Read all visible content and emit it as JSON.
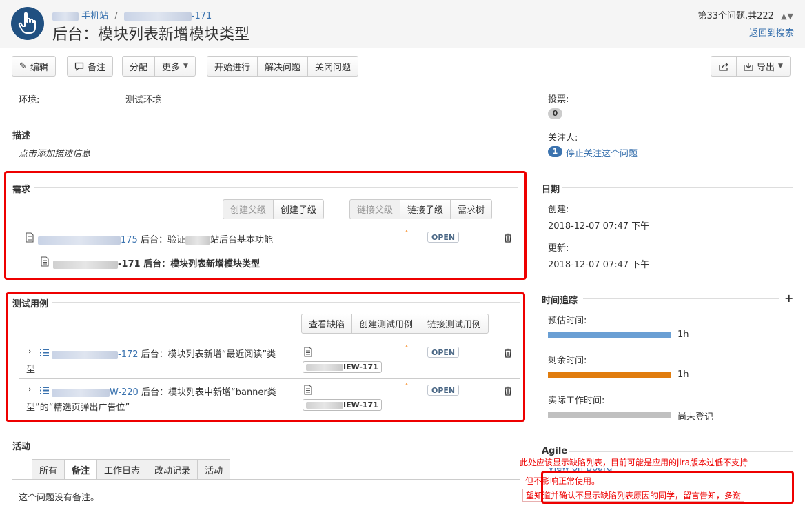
{
  "breadcrumb": {
    "project": "手机站",
    "sep": "/",
    "issue_key_suffix": "-171"
  },
  "title": "后台：模块列表新增模块类型",
  "pager": {
    "position": "第33个问题,共222",
    "arrows": "▲▼",
    "return": "返回到搜索"
  },
  "toolbar": {
    "edit": "编辑",
    "comment": "备注",
    "assign": "分配",
    "more": "更多",
    "start": "开始进行",
    "resolve": "解决问题",
    "close": "关闭问题",
    "export": "导出"
  },
  "details": {
    "env_label": "环境:",
    "env_value": "测试环境"
  },
  "description": {
    "heading": "描述",
    "placeholder": "点击添加描述信息"
  },
  "requirements": {
    "heading": "需求",
    "buttons": [
      "创建父级",
      "创建子级",
      "链接父级",
      "链接子级",
      "需求树"
    ],
    "rows": [
      {
        "key_suffix": "175",
        "summary": "后台：验证",
        "summary_tail": "站后台基本功能",
        "status": "OPEN"
      },
      {
        "key_suffix": "-171",
        "summary": "后台：模块列表新增模块类型"
      }
    ]
  },
  "testcases": {
    "heading": "测试用例",
    "buttons": [
      "查看缺陷",
      "创建测试用例",
      "链接测试用例"
    ],
    "rows": [
      {
        "key_suffix": "-172",
        "summary_1": "后台：模块列表新增“最近阅读”类",
        "summary_2": "型",
        "tag_suffix": "IEW-171",
        "status": "OPEN"
      },
      {
        "key_suffix": "W-220",
        "summary_1": "后台：模块列表中新增“banner类",
        "summary_2": "型”的“精选页弹出广告位”",
        "tag_suffix": "IEW-171",
        "status": "OPEN"
      }
    ]
  },
  "activity": {
    "heading": "活动",
    "tabs": [
      "所有",
      "备注",
      "工作日志",
      "改动记录",
      "活动"
    ],
    "empty": "这个问题没有备注。"
  },
  "people": {
    "votes_label": "投票:",
    "votes": "0",
    "watchers_label": "关注人:",
    "watchers": "1",
    "unwatch": "停止关注这个问题"
  },
  "dates": {
    "heading": "日期",
    "created_label": "创建:",
    "created": "2018-12-07 07:47 下午",
    "updated_label": "更新:",
    "updated": "2018-12-07 07:47 下午"
  },
  "time_tracking": {
    "heading": "时间追踪",
    "add": "+",
    "estimated_label": "预估时间:",
    "estimated": "1h",
    "estimated_fraction": 1.0,
    "remaining_label": "剩余时间:",
    "remaining": "1h",
    "remaining_fraction": 1.0,
    "logged_label": "实际工作时间:",
    "logged": "尚未登记",
    "logged_fraction": 0.0
  },
  "agile": {
    "heading": "Agile",
    "link": "View on Board"
  },
  "annotation": {
    "line1": "此处应该显示缺陷列表，目前可能是应用的jira版本过低不支持",
    "line2": "但不影响正常使用。",
    "line3": "望知道并确认不显示缺陷列表原因的同学，留言告知，多谢"
  },
  "colors": {
    "estimate": "#6a9fd4",
    "remaining": "#e07c0e",
    "logged": "#c0c0c0",
    "highlight": "#e00000"
  }
}
